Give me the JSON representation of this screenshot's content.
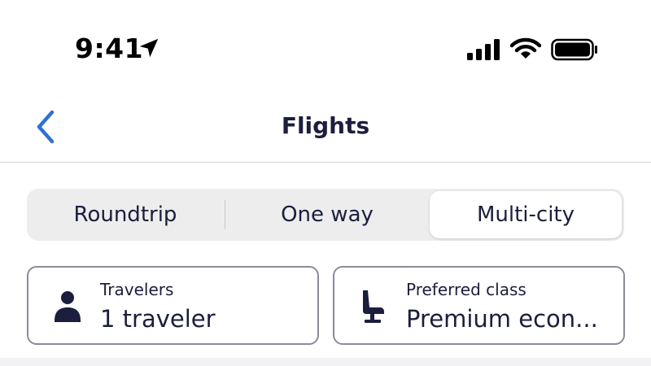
{
  "status_bar": {
    "time": "9:41",
    "icons": [
      "location-arrow-icon",
      "cellular-signal-icon",
      "wifi-icon",
      "battery-icon"
    ]
  },
  "nav": {
    "title": "Flights",
    "back_icon": "chevron-left-icon",
    "accent_color": "#2f6fd6"
  },
  "trip_type": {
    "options": [
      {
        "label": "Roundtrip",
        "selected": false
      },
      {
        "label": "One way",
        "selected": false
      },
      {
        "label": "Multi-city",
        "selected": true
      }
    ]
  },
  "travelers": {
    "label": "Travelers",
    "value": "1 traveler",
    "icon": "person-icon"
  },
  "preferred_class": {
    "label": "Preferred class",
    "value": "Premium econ...",
    "icon": "seat-icon"
  },
  "colors": {
    "text": "#1b1e3d",
    "card_border": "#8a8c99",
    "segment_bg": "#ededed",
    "selected_segment_bg": "#ffffff"
  }
}
